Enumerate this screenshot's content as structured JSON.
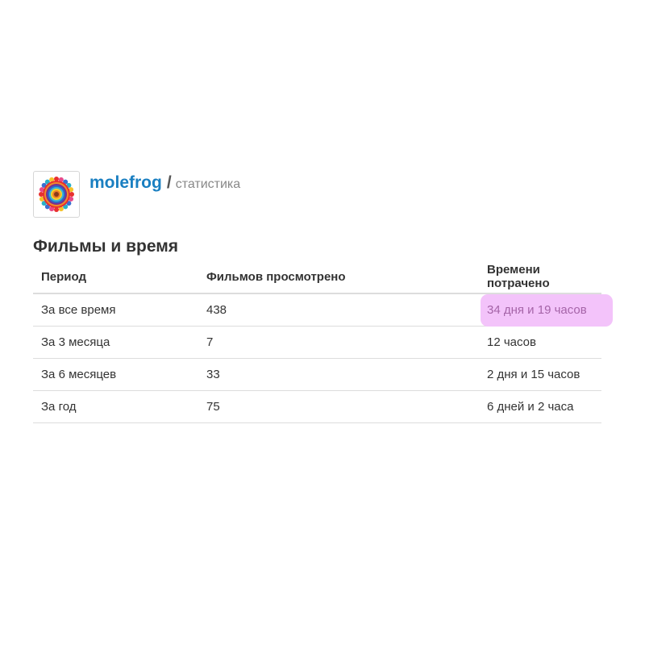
{
  "profile": {
    "username": "molefrog",
    "separator": "/",
    "subpage": "статистика",
    "avatar_icon": "mandala-avatar-icon"
  },
  "section": {
    "title": "Фильмы и время"
  },
  "table": {
    "headers": {
      "period": "Период",
      "films": "Фильмов просмотрено",
      "time": "Времени потрачено"
    },
    "rows": [
      {
        "period": "За все время",
        "films": "438",
        "time": "34 дня и 19 часов"
      },
      {
        "period": "За 3 месяца",
        "films": "7",
        "time": "12 часов"
      },
      {
        "period": "За 6 месяцев",
        "films": "33",
        "time": "2 дня и 15 часов"
      },
      {
        "period": "За год",
        "films": "75",
        "time": "6 дней и 2 часа"
      }
    ]
  },
  "colors": {
    "link": "#1a7fc1",
    "highlight": "#f3c3fa",
    "highlight_text": "#a564a8"
  }
}
